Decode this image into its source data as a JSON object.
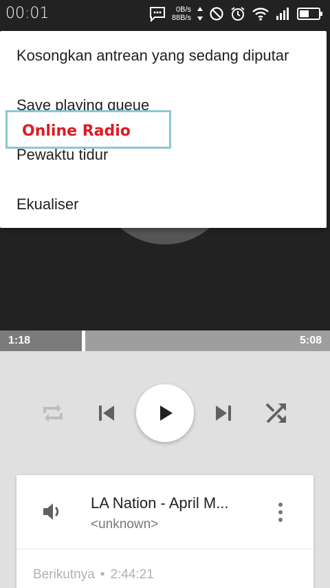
{
  "status_bar": {
    "time": "00:01",
    "net_up": "0B/s",
    "net_down": "88B/s",
    "icons": [
      "message-icon",
      "do-not-disturb-icon",
      "alarm-icon",
      "wifi-icon",
      "signal-icon",
      "battery-icon"
    ]
  },
  "menu": {
    "items": [
      "Kosongkan antrean yang sedang diputar",
      "Save playing queue",
      "Pewaktu tidur",
      "Ekualiser"
    ]
  },
  "overlay_label": "Online Radio",
  "player": {
    "current_time": "1:18",
    "duration": "5:08",
    "progress_fraction": 0.253
  },
  "controls": [
    "repeat-icon",
    "previous-icon",
    "play-icon",
    "next-icon",
    "shuffle-icon"
  ],
  "now_playing": {
    "title": "LA Nation - April M...",
    "artist": "<unknown>",
    "next_label": "Berikutnya",
    "separator": "•",
    "next_time": "2:44:21"
  },
  "colors": {
    "art_background": "#222222",
    "player_background": "#e0e0e0",
    "label_text": "#dd1a22",
    "label_border": "#8cc7d8"
  }
}
